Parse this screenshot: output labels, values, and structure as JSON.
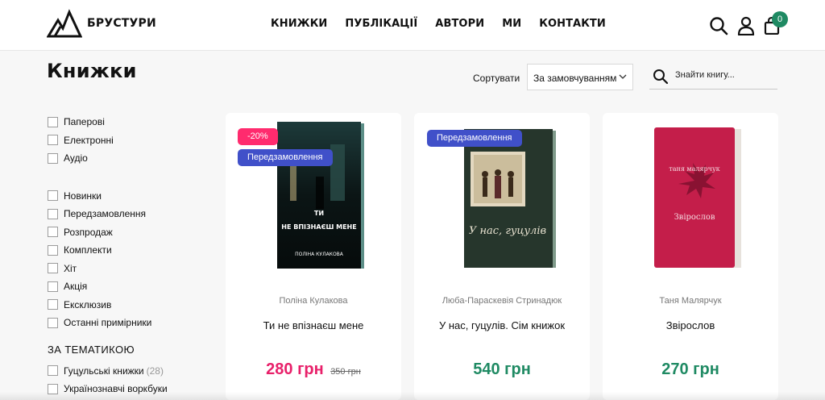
{
  "brand": {
    "name": "БРУСТУРИ"
  },
  "nav": [
    {
      "label": "КНИЖКИ"
    },
    {
      "label": "ПУБЛІКАЦІЇ"
    },
    {
      "label": "АВТОРИ"
    },
    {
      "label": "МИ"
    },
    {
      "label": "КОНТАКТИ"
    }
  ],
  "header_icons": [
    "search-icon",
    "user-icon",
    "cart-icon"
  ],
  "cart": {
    "count": "0"
  },
  "page": {
    "title": "Книжки"
  },
  "sort": {
    "label": "Сортувати",
    "selected": "За замовчуванням"
  },
  "search": {
    "placeholder": "Знайти книгу..."
  },
  "filters": {
    "format": [
      "Паперові",
      "Електронні",
      "Аудіо"
    ],
    "status": [
      "Новинки",
      "Передзамовлення",
      "Розпродаж",
      "Комплекти",
      "Хіт",
      "Акція",
      "Ексклюзив",
      "Останні примірники"
    ],
    "topic_heading": "ЗА ТЕМАТИКОЮ",
    "topics": [
      {
        "label": "Гуцульські книжки",
        "count": "(28)"
      },
      {
        "label": "Українознавчі воркбуки",
        "count": ""
      }
    ]
  },
  "colors": {
    "sale_price": "#e8206a",
    "price": "#1f8a63",
    "preorder_badge": "#4050c9",
    "sale_badge": "#ff2b6e",
    "accent": "#1f8a63"
  },
  "products": [
    {
      "author": "Поліна Кулакова",
      "title": "Ти не впізнаєш мене",
      "price": "280 грн",
      "old_price": "350 грн",
      "badges": [
        "-20%",
        "Передзамовлення"
      ],
      "cover": {
        "top_text": "ТИ",
        "main_text": "НЕ ВПІЗНАЄШ МЕНЕ",
        "author_text": "ПОЛІНА КУЛАКОВА"
      }
    },
    {
      "author": "Люба-Параскевія Стринадюк",
      "title": "У нас, гуцулів. Сім книжок",
      "price": "540 грн",
      "old_price": "",
      "badges": [
        "Передзамовлення"
      ],
      "cover": {
        "main_text": "У нас, гуцулів"
      }
    },
    {
      "author": "Таня Малярчук",
      "title": "Звірослов",
      "price": "270 грн",
      "old_price": "",
      "badges": [],
      "cover": {
        "author_text": "таня малярчук",
        "main_text": "Звірослов"
      }
    }
  ]
}
